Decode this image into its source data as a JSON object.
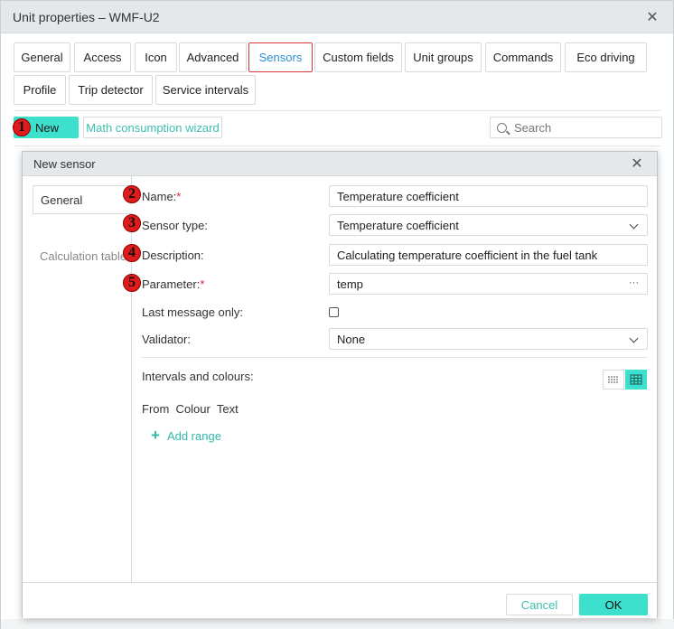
{
  "outer": {
    "title": "Unit properties – WMF-U2",
    "tabs": [
      "General",
      "Access",
      "Icon",
      "Advanced",
      "Sensors",
      "Custom fields",
      "Unit groups",
      "Commands",
      "Eco driving",
      "Profile",
      "Trip detector",
      "Service intervals"
    ],
    "active_tab": "Sensors",
    "new_label": "New",
    "math_label": "Math consumption wizard",
    "search_placeholder": "Search"
  },
  "markers": [
    "1",
    "2",
    "3",
    "4",
    "5"
  ],
  "dialog": {
    "title": "New sensor",
    "side_items": [
      "General",
      "Calculation table"
    ],
    "fields": {
      "name_label": "Name:",
      "name_value": "Temperature coefficient",
      "type_label": "Sensor type:",
      "type_value": "Temperature coefficient",
      "description_label": "Description:",
      "description_value": "Calculating temperature coefficient in the fuel tank",
      "parameter_label": "Parameter:",
      "parameter_value": "temp",
      "last_message_label": "Last message only:",
      "validator_label": "Validator:",
      "validator_value": "None",
      "intervals_label": "Intervals and colours:"
    },
    "required_mark": "*",
    "more_glyph": "···",
    "columns": "From  Colour  Text",
    "add_range_label": "Add range",
    "cancel_label": "Cancel",
    "ok_label": "OK"
  },
  "colors": {
    "accent": "#3de0cc",
    "link": "#3cbfae",
    "active_tab_border": "#d9363e",
    "active_tab_text": "#2d8ecf",
    "marker": "#e01b1b"
  },
  "icons": [
    "close-icon",
    "search-icon",
    "chevron-down-icon",
    "more-icon",
    "plus-icon",
    "list-view-icon",
    "table-view-icon"
  ]
}
